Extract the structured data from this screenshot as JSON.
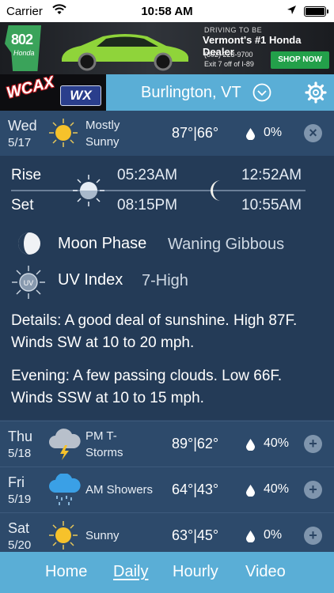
{
  "status": {
    "carrier": "Carrier",
    "time": "10:58 AM"
  },
  "ad": {
    "number": "802",
    "brand": "Honda",
    "tagline": "DRIVING TO BE",
    "headline": "Vermont's #1 Honda Dealer",
    "phone": "(802) 223-9700",
    "exit": "Exit 7 off of I-89",
    "cta": "SHOP NOW",
    "car_color": "#8fd43a"
  },
  "header": {
    "logo_text": "WCAX",
    "logo_badge": "WX",
    "location": "Burlington, VT",
    "accent": "#5aaed6"
  },
  "today": {
    "day": "Wed",
    "date": "5/17",
    "condition_line1": "Mostly",
    "condition_line2": "Sunny",
    "temps": "87°|66°",
    "precip": "0%",
    "icon": "sun-icon"
  },
  "detail": {
    "rise_label": "Rise",
    "set_label": "Set",
    "sunrise": "05:23AM",
    "sunset": "08:15PM",
    "moonrise": "12:52AM",
    "moonset": "10:55AM",
    "moon_phase_label": "Moon Phase",
    "moon_phase_value": "Waning Gibbous",
    "uv_label": "UV Index",
    "uv_value": "7-High",
    "uv_badge": "UV",
    "details": "Details: A good deal of sunshine. High 87F. Winds SW at 10 to 20 mph.",
    "evening": "Evening: A few passing clouds. Low 66F. Winds SSW at 10 to 15 mph."
  },
  "forecast": [
    {
      "day": "Thu",
      "date": "5/18",
      "condition_line1": "PM T-",
      "condition_line2": "Storms",
      "temps": "89°|62°",
      "precip": "40%",
      "icon": "thunderstorm-icon"
    },
    {
      "day": "Fri",
      "date": "5/19",
      "condition_line1": "AM Showers",
      "condition_line2": "",
      "temps": "64°|43°",
      "precip": "40%",
      "icon": "rain-icon"
    },
    {
      "day": "Sat",
      "date": "5/20",
      "condition_line1": "Sunny",
      "condition_line2": "",
      "temps": "63°|45°",
      "precip": "0%",
      "icon": "sun-icon"
    }
  ],
  "tabs": [
    {
      "label": "Home",
      "active": false
    },
    {
      "label": "Daily",
      "active": true
    },
    {
      "label": "Hourly",
      "active": false
    },
    {
      "label": "Video",
      "active": false
    }
  ]
}
